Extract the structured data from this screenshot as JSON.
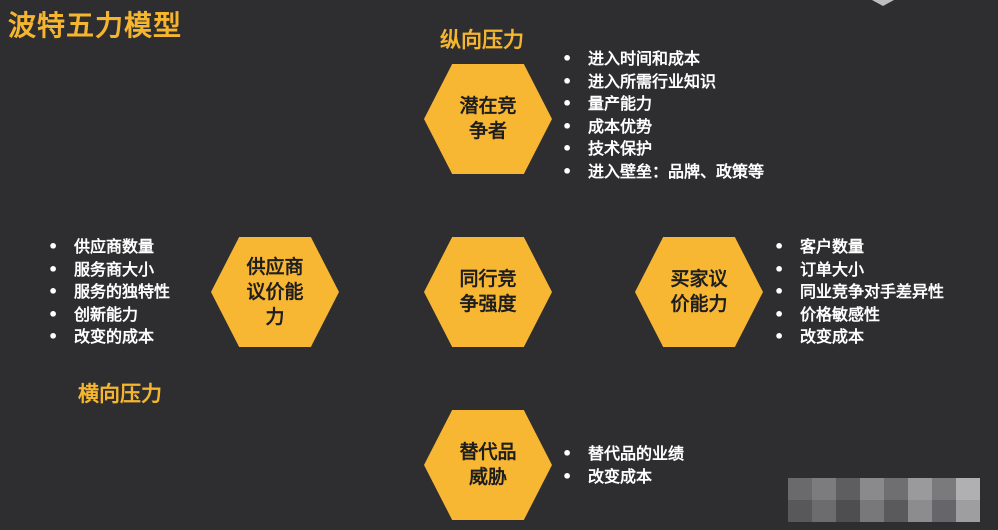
{
  "title": "波特五力模型",
  "labels": {
    "vertical": "纵向压力",
    "horizontal": "横向压力"
  },
  "nodes": {
    "potential": {
      "line1": "潜在竞",
      "line2": "争者",
      "bullets": [
        "进入时间和成本",
        "进入所需行业知识",
        "量产能力",
        "成本优势",
        "技术保护",
        "进入壁垒：品牌、政策等"
      ]
    },
    "supplier": {
      "line1": "供应商",
      "line2": "议价能",
      "line3": "力",
      "bullets": [
        "供应商数量",
        "服务商大小",
        "服务的独特性",
        "创新能力",
        "改变的成本"
      ]
    },
    "rivalry": {
      "line1": "同行竞",
      "line2": "争强度"
    },
    "buyer": {
      "line1": "买家议",
      "line2": "价能力",
      "bullets": [
        "客户数量",
        "订单大小",
        "同业竞争对手差异性",
        "价格敏感性",
        "改变成本"
      ]
    },
    "substitute": {
      "line1": "替代品",
      "line2": "威胁",
      "bullets": [
        "替代品的业绩",
        "改变成本"
      ]
    }
  },
  "colors": {
    "accent": "#f5b52e",
    "hex_fill": "#f8b732",
    "background": "#2e2e30"
  }
}
